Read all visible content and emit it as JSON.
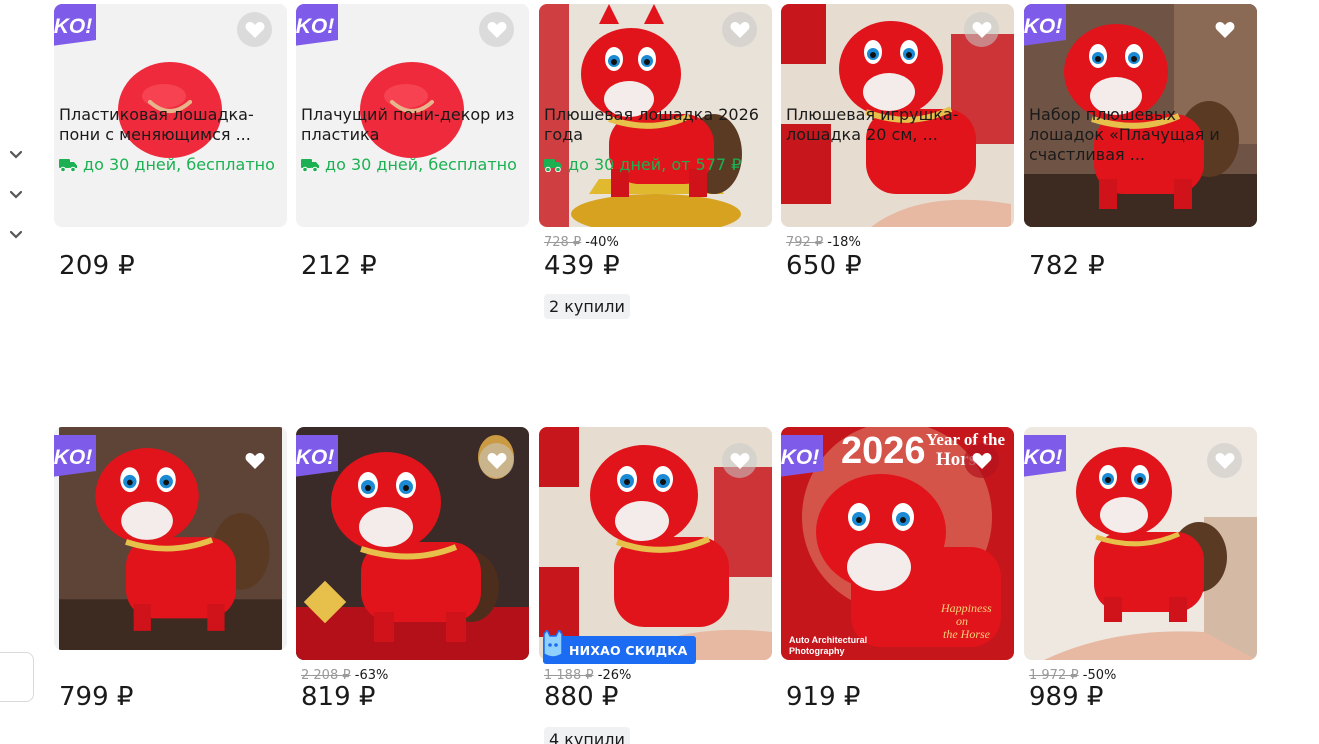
{
  "colors": {
    "accent_green": "#1bb152",
    "ko_purple": "#7e5be9",
    "nihao_blue": "#1b6cf2",
    "product_red": "#e1141b"
  },
  "sidebar": {
    "chevrons": [
      "chevron-down",
      "chevron-down",
      "chevron-down"
    ]
  },
  "badges": {
    "ko": "KO!",
    "nihao": "НИХАО СКИДКА"
  },
  "products": [
    {
      "price": "209 ₽",
      "title": "Пластиковая лошадка-пони с меняющимся ...",
      "delivery": "до 30 дней, бесплатно",
      "ko": true,
      "favorited": false,
      "image": "red-smiley-ball"
    },
    {
      "price": "212 ₽",
      "title": "Плачущий пони-декор из пластика",
      "delivery": "до 30 дней, бесплатно",
      "ko": true,
      "favorited": false,
      "image": "red-smiley-ball"
    },
    {
      "old_price": "728 ₽",
      "discount": "-40%",
      "price": "439 ₽",
      "bought": "2 купили",
      "title": "Плюшевая лошадка 2026 года",
      "delivery": "до 30 дней, от 577 ₽",
      "ko": false,
      "favorited": false,
      "image": "red-plush-horse"
    },
    {
      "old_price": "792 ₽",
      "discount": "-18%",
      "price": "650 ₽",
      "title": "Плюшевая игрушка-лошадка 20 см, ...",
      "ko": false,
      "favorited": false,
      "image": "red-plush-horse"
    },
    {
      "price": "782 ₽",
      "title": "Набор плюшевых лошадок «Плачущая и счастливая ...",
      "ko": true,
      "favorited": true,
      "image": "red-plush-horse"
    },
    {
      "price": "799 ₽",
      "ko": true,
      "favorited": true,
      "image": "red-plush-horse"
    },
    {
      "old_price": "2 208 ₽",
      "discount": "-63%",
      "price": "819 ₽",
      "ko": true,
      "favorited": false,
      "image": "red-plush-horse"
    },
    {
      "old_price": "1 188 ₽",
      "discount": "-26%",
      "price": "880 ₽",
      "bought": "4 купили",
      "ko": false,
      "favorited": false,
      "nihao": true,
      "image": "red-plush-horse"
    },
    {
      "price": "919 ₽",
      "ko": true,
      "favorited": true,
      "image": "red-plush-horse",
      "overlay_text": "2026 Year of the Horse"
    },
    {
      "old_price": "1 972 ₽",
      "discount": "-50%",
      "price": "989 ₽",
      "ko": true,
      "favorited": false,
      "image": "red-plush-horse"
    }
  ],
  "overlay": {
    "year": "2026",
    "year_of": "Year of the",
    "horse": "Horse",
    "happiness": "Happiness",
    "on": "on",
    "the_horse": "the Horse",
    "auto": "Auto Architectural",
    "photography": "Photography"
  }
}
